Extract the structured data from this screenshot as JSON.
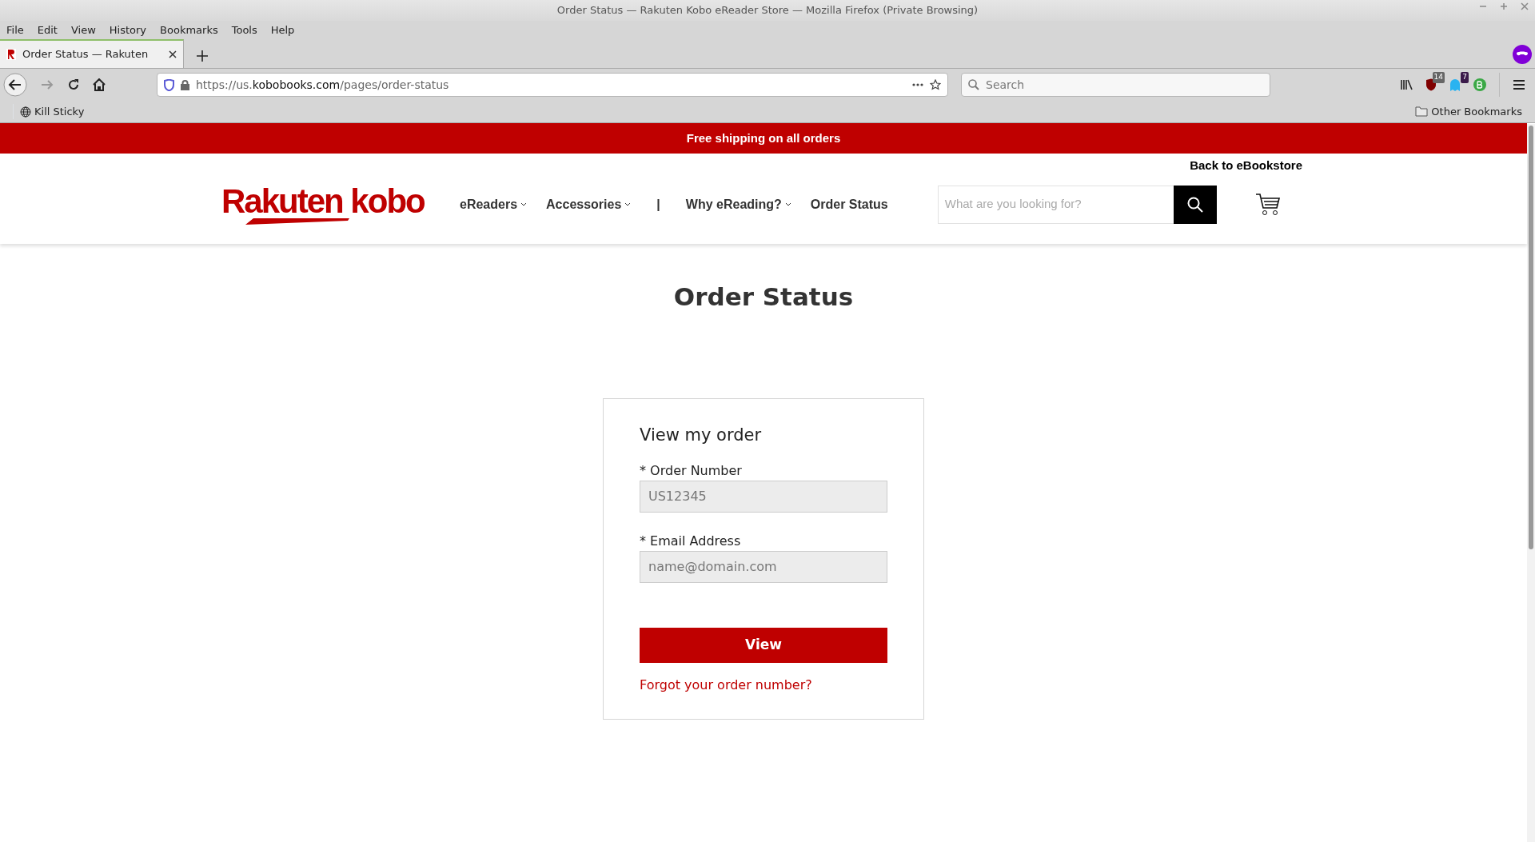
{
  "window": {
    "title": "Order Status — Rakuten Kobo eReader Store — Mozilla Firefox (Private Browsing)"
  },
  "menu_bar": [
    "File",
    "Edit",
    "View",
    "History",
    "Bookmarks",
    "Tools",
    "Help"
  ],
  "tabs": [
    {
      "label": "Order Status — Rakuten",
      "selected": true
    }
  ],
  "address_bar": {
    "prefix": "https://us.",
    "domain": "kobobooks.com",
    "path": "/pages/order-status"
  },
  "browser_search": {
    "placeholder": "Search"
  },
  "extension_badges": [
    "14",
    "7"
  ],
  "bookmarks": [
    {
      "label": "Kill Sticky"
    },
    {
      "label": "Other Bookmarks"
    }
  ],
  "page": {
    "banner": "Free shipping on all orders",
    "back_link": "Back to eBookstore",
    "logo": "Rakuten kobo",
    "nav": [
      {
        "label": "eReaders",
        "dropdown": true
      },
      {
        "label": "Accessories",
        "dropdown": true
      },
      {
        "label": "|",
        "kind": "separator"
      },
      {
        "label": "Why eReading?",
        "dropdown": true
      },
      {
        "label": "Order Status",
        "dropdown": false
      }
    ],
    "search": {
      "placeholder": "What are you looking for?"
    },
    "heading": "Order Status",
    "form": {
      "title": "View my order",
      "fields": [
        {
          "label": "* Order Number",
          "placeholder": "US12345"
        },
        {
          "label": "* Email Address",
          "placeholder": "name@domain.com"
        }
      ],
      "submit": "View",
      "link": "Forgot your order number?"
    }
  }
}
